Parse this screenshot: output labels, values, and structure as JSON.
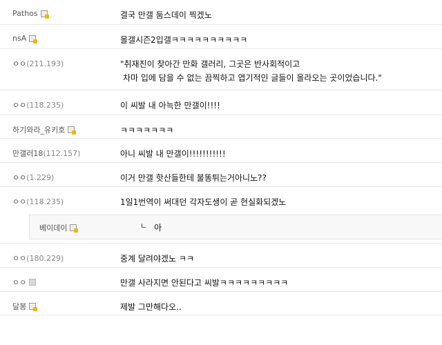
{
  "comments": [
    {
      "name": "Pathos",
      "ip": "",
      "icon": "lock",
      "text": "결국 만갤 둠스데이 찍겠노"
    },
    {
      "name": "nsA",
      "ip": "",
      "icon": "lock",
      "text": "올갤시즌2입갤ㅋㅋㅋㅋㅋㅋㅋㅋㅋㅋ"
    },
    {
      "name": "ㅇㅇ",
      "ip": "(211.193)",
      "icon": "",
      "text_lines": [
        "\"취재진이 찾아간 만화 갤러리, 그곳은 반사회적이고",
        "차마 입에 담을 수 없는 끔찍하고 엽기적인 글들이 올라오는 곳이었습니다.\""
      ]
    },
    {
      "name": "ㅇㅇ",
      "ip": "(118.235)",
      "icon": "",
      "text": "이 씨발 내 아늑한 만갤이!!!!"
    },
    {
      "name": "하기와라_유키호",
      "ip": "",
      "icon": "lock",
      "text": "ㅋㅋㅋㅋㅋㅋㅋ"
    },
    {
      "name": "만갤러18",
      "ip": "(112.157)",
      "icon": "",
      "text": "아니 씨발 내 만갤이!!!!!!!!!!!"
    },
    {
      "name": "ㅇㅇ",
      "ip": "(1.229)",
      "icon": "",
      "text": "이거 만갤 핫산들한테 불똥튀는거아니노??"
    },
    {
      "name": "ㅇㅇ",
      "ip": "(118.235)",
      "icon": "",
      "text": "1일1번역이 써대던 각자도생이 곧 현실화되겠노"
    },
    {
      "name": "ㅇㅇ",
      "ip": "(180.229)",
      "icon": "",
      "text": "중계 달려야겠노 ㅋㅋ"
    },
    {
      "name": "ㅇㅇ",
      "ip": "",
      "icon": "gray",
      "text": "만갤 사라지면 안된다고 씨발ㅋㅋㅋㅋㅋㅋㅋㅋㅋ"
    },
    {
      "name": "달봉",
      "ip": "",
      "icon": "lock",
      "text": "제발 그만해다오.."
    }
  ],
  "reply": {
    "name": "베이데이",
    "icon": "lock",
    "arrow": "ㄴ",
    "text": "아"
  }
}
